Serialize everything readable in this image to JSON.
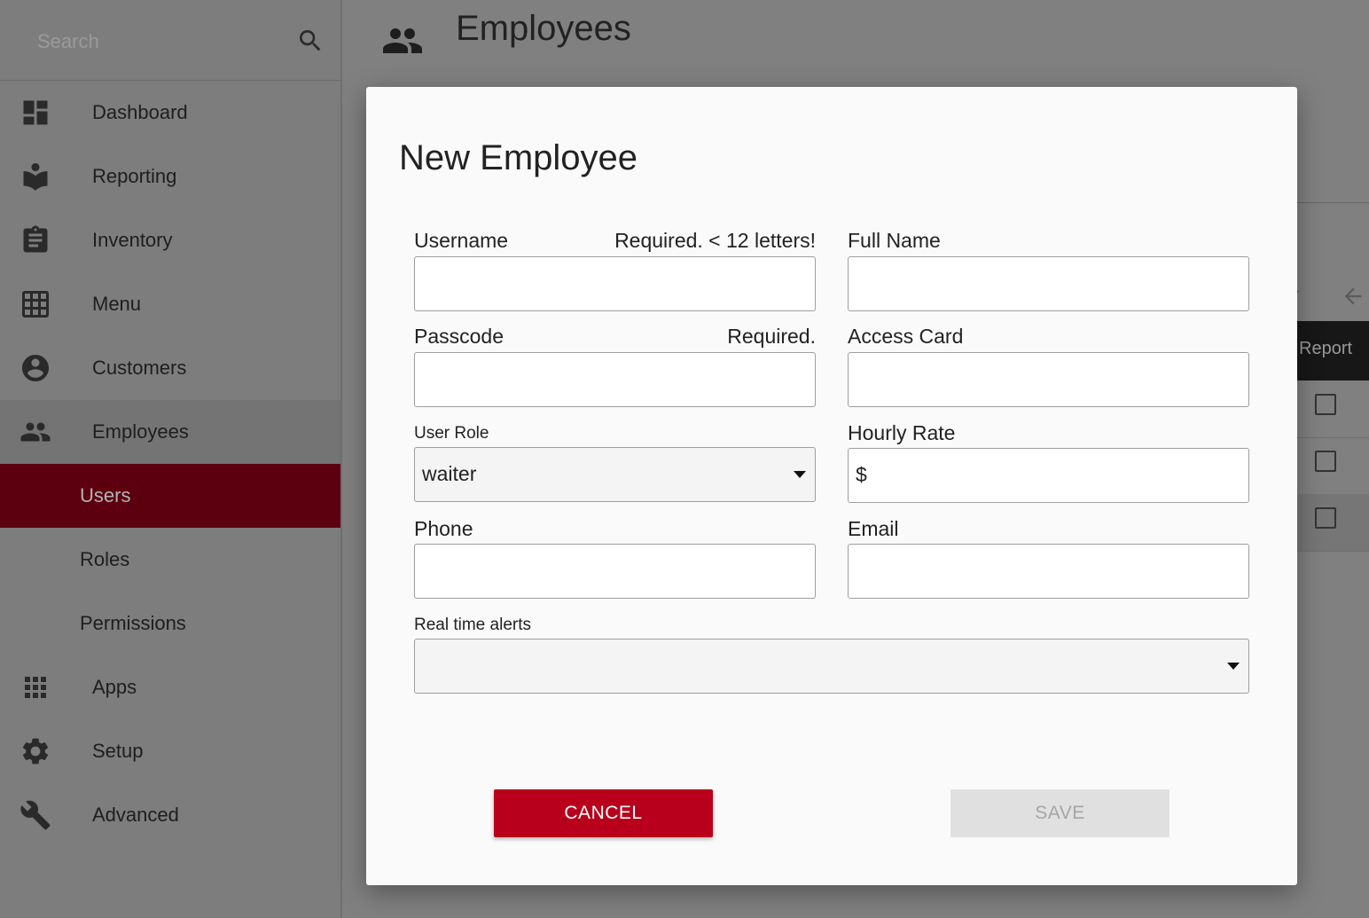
{
  "sidebar": {
    "search_placeholder": "Search",
    "items": [
      {
        "label": "Dashboard",
        "icon": "dashboard-icon"
      },
      {
        "label": "Reporting",
        "icon": "reporting-icon"
      },
      {
        "label": "Inventory",
        "icon": "clipboard-icon"
      },
      {
        "label": "Menu",
        "icon": "grid-icon"
      },
      {
        "label": "Customers",
        "icon": "account-circle-icon"
      },
      {
        "label": "Employees",
        "icon": "people-icon"
      },
      {
        "label": "Users",
        "icon": ""
      },
      {
        "label": "Roles",
        "icon": ""
      },
      {
        "label": "Permissions",
        "icon": ""
      },
      {
        "label": "Apps",
        "icon": "apps-icon"
      },
      {
        "label": "Setup",
        "icon": "gear-icon"
      },
      {
        "label": "Advanced",
        "icon": "wrench-icon"
      }
    ],
    "active_item": "Users"
  },
  "header": {
    "title": "Employees",
    "icon": "people-icon"
  },
  "background": {
    "report_label": "Report"
  },
  "dialog": {
    "title": "New Employee",
    "fields": {
      "username": {
        "label": "Username",
        "hint": "Required. < 12 letters!",
        "value": ""
      },
      "full_name": {
        "label": "Full Name",
        "value": ""
      },
      "passcode": {
        "label": "Passcode",
        "hint": "Required.",
        "value": ""
      },
      "access_card": {
        "label": "Access Card",
        "value": ""
      },
      "user_role": {
        "label": "User Role",
        "value": "waiter"
      },
      "hourly_rate": {
        "label": "Hourly Rate",
        "prefix": "$",
        "value": ""
      },
      "phone": {
        "label": "Phone",
        "value": ""
      },
      "email": {
        "label": "Email",
        "value": ""
      },
      "real_time_alerts": {
        "label": "Real time alerts",
        "value": ""
      }
    },
    "cancel_label": "CANCEL",
    "save_label": "SAVE"
  },
  "colors": {
    "accent": "#b8001c",
    "active_nav": "#5c0010",
    "overlay": "#808080"
  }
}
